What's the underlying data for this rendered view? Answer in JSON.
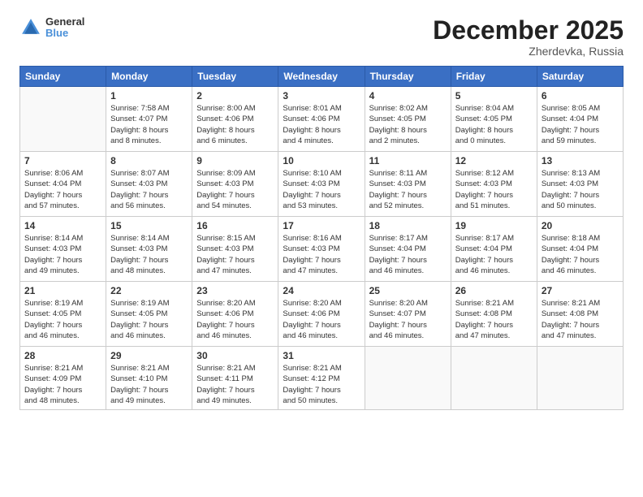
{
  "logo": {
    "line1": "General",
    "line2": "Blue"
  },
  "title": "December 2025",
  "subtitle": "Zherdevka, Russia",
  "header": {
    "days": [
      "Sunday",
      "Monday",
      "Tuesday",
      "Wednesday",
      "Thursday",
      "Friday",
      "Saturday"
    ]
  },
  "weeks": [
    [
      {
        "day": "",
        "info": ""
      },
      {
        "day": "1",
        "info": "Sunrise: 7:58 AM\nSunset: 4:07 PM\nDaylight: 8 hours\nand 8 minutes."
      },
      {
        "day": "2",
        "info": "Sunrise: 8:00 AM\nSunset: 4:06 PM\nDaylight: 8 hours\nand 6 minutes."
      },
      {
        "day": "3",
        "info": "Sunrise: 8:01 AM\nSunset: 4:06 PM\nDaylight: 8 hours\nand 4 minutes."
      },
      {
        "day": "4",
        "info": "Sunrise: 8:02 AM\nSunset: 4:05 PM\nDaylight: 8 hours\nand 2 minutes."
      },
      {
        "day": "5",
        "info": "Sunrise: 8:04 AM\nSunset: 4:05 PM\nDaylight: 8 hours\nand 0 minutes."
      },
      {
        "day": "6",
        "info": "Sunrise: 8:05 AM\nSunset: 4:04 PM\nDaylight: 7 hours\nand 59 minutes."
      }
    ],
    [
      {
        "day": "7",
        "info": "Sunrise: 8:06 AM\nSunset: 4:04 PM\nDaylight: 7 hours\nand 57 minutes."
      },
      {
        "day": "8",
        "info": "Sunrise: 8:07 AM\nSunset: 4:03 PM\nDaylight: 7 hours\nand 56 minutes."
      },
      {
        "day": "9",
        "info": "Sunrise: 8:09 AM\nSunset: 4:03 PM\nDaylight: 7 hours\nand 54 minutes."
      },
      {
        "day": "10",
        "info": "Sunrise: 8:10 AM\nSunset: 4:03 PM\nDaylight: 7 hours\nand 53 minutes."
      },
      {
        "day": "11",
        "info": "Sunrise: 8:11 AM\nSunset: 4:03 PM\nDaylight: 7 hours\nand 52 minutes."
      },
      {
        "day": "12",
        "info": "Sunrise: 8:12 AM\nSunset: 4:03 PM\nDaylight: 7 hours\nand 51 minutes."
      },
      {
        "day": "13",
        "info": "Sunrise: 8:13 AM\nSunset: 4:03 PM\nDaylight: 7 hours\nand 50 minutes."
      }
    ],
    [
      {
        "day": "14",
        "info": "Sunrise: 8:14 AM\nSunset: 4:03 PM\nDaylight: 7 hours\nand 49 minutes."
      },
      {
        "day": "15",
        "info": "Sunrise: 8:14 AM\nSunset: 4:03 PM\nDaylight: 7 hours\nand 48 minutes."
      },
      {
        "day": "16",
        "info": "Sunrise: 8:15 AM\nSunset: 4:03 PM\nDaylight: 7 hours\nand 47 minutes."
      },
      {
        "day": "17",
        "info": "Sunrise: 8:16 AM\nSunset: 4:03 PM\nDaylight: 7 hours\nand 47 minutes."
      },
      {
        "day": "18",
        "info": "Sunrise: 8:17 AM\nSunset: 4:04 PM\nDaylight: 7 hours\nand 46 minutes."
      },
      {
        "day": "19",
        "info": "Sunrise: 8:17 AM\nSunset: 4:04 PM\nDaylight: 7 hours\nand 46 minutes."
      },
      {
        "day": "20",
        "info": "Sunrise: 8:18 AM\nSunset: 4:04 PM\nDaylight: 7 hours\nand 46 minutes."
      }
    ],
    [
      {
        "day": "21",
        "info": "Sunrise: 8:19 AM\nSunset: 4:05 PM\nDaylight: 7 hours\nand 46 minutes."
      },
      {
        "day": "22",
        "info": "Sunrise: 8:19 AM\nSunset: 4:05 PM\nDaylight: 7 hours\nand 46 minutes."
      },
      {
        "day": "23",
        "info": "Sunrise: 8:20 AM\nSunset: 4:06 PM\nDaylight: 7 hours\nand 46 minutes."
      },
      {
        "day": "24",
        "info": "Sunrise: 8:20 AM\nSunset: 4:06 PM\nDaylight: 7 hours\nand 46 minutes."
      },
      {
        "day": "25",
        "info": "Sunrise: 8:20 AM\nSunset: 4:07 PM\nDaylight: 7 hours\nand 46 minutes."
      },
      {
        "day": "26",
        "info": "Sunrise: 8:21 AM\nSunset: 4:08 PM\nDaylight: 7 hours\nand 47 minutes."
      },
      {
        "day": "27",
        "info": "Sunrise: 8:21 AM\nSunset: 4:08 PM\nDaylight: 7 hours\nand 47 minutes."
      }
    ],
    [
      {
        "day": "28",
        "info": "Sunrise: 8:21 AM\nSunset: 4:09 PM\nDaylight: 7 hours\nand 48 minutes."
      },
      {
        "day": "29",
        "info": "Sunrise: 8:21 AM\nSunset: 4:10 PM\nDaylight: 7 hours\nand 49 minutes."
      },
      {
        "day": "30",
        "info": "Sunrise: 8:21 AM\nSunset: 4:11 PM\nDaylight: 7 hours\nand 49 minutes."
      },
      {
        "day": "31",
        "info": "Sunrise: 8:21 AM\nSunset: 4:12 PM\nDaylight: 7 hours\nand 50 minutes."
      },
      {
        "day": "",
        "info": ""
      },
      {
        "day": "",
        "info": ""
      },
      {
        "day": "",
        "info": ""
      }
    ]
  ]
}
